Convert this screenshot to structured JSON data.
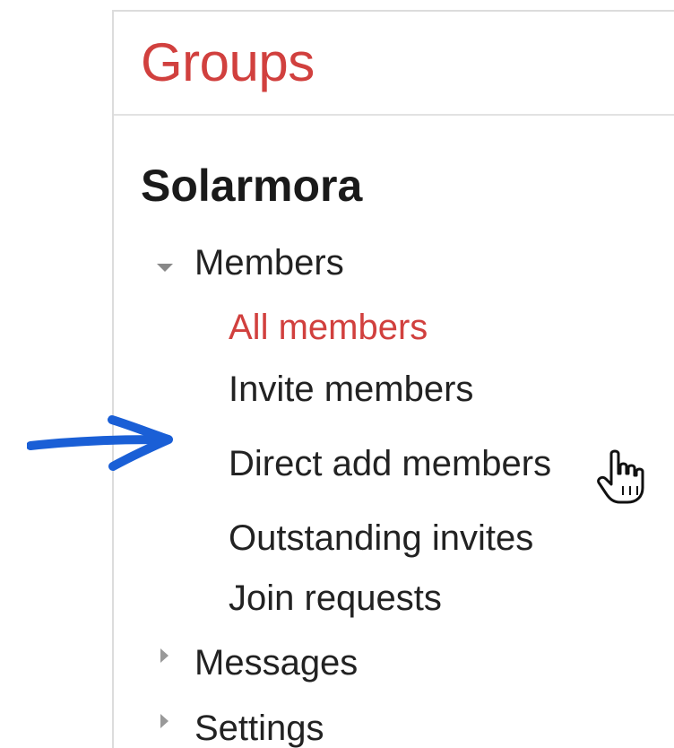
{
  "header": {
    "title": "Groups"
  },
  "group": {
    "name": "Solarmora"
  },
  "nav": {
    "members_label": "Members",
    "members_items": [
      {
        "label": "All members",
        "active": true
      },
      {
        "label": "Invite members",
        "active": false
      },
      {
        "label": "Direct add members",
        "active": false,
        "hovered": true
      },
      {
        "label": "Outstanding invites",
        "active": false
      },
      {
        "label": "Join requests",
        "active": false
      }
    ],
    "messages_label": "Messages",
    "settings_label": "Settings"
  },
  "icons": {
    "members_expander": "caret-down-icon",
    "collapsed_expander": "caret-right-icon",
    "pointer": "hand-cursor-icon",
    "callout": "arrow-annotation"
  },
  "colors": {
    "accent": "#d1403e",
    "text": "#222222",
    "hover_bg": "#eeeeee",
    "annotation": "#1a5fd6"
  }
}
